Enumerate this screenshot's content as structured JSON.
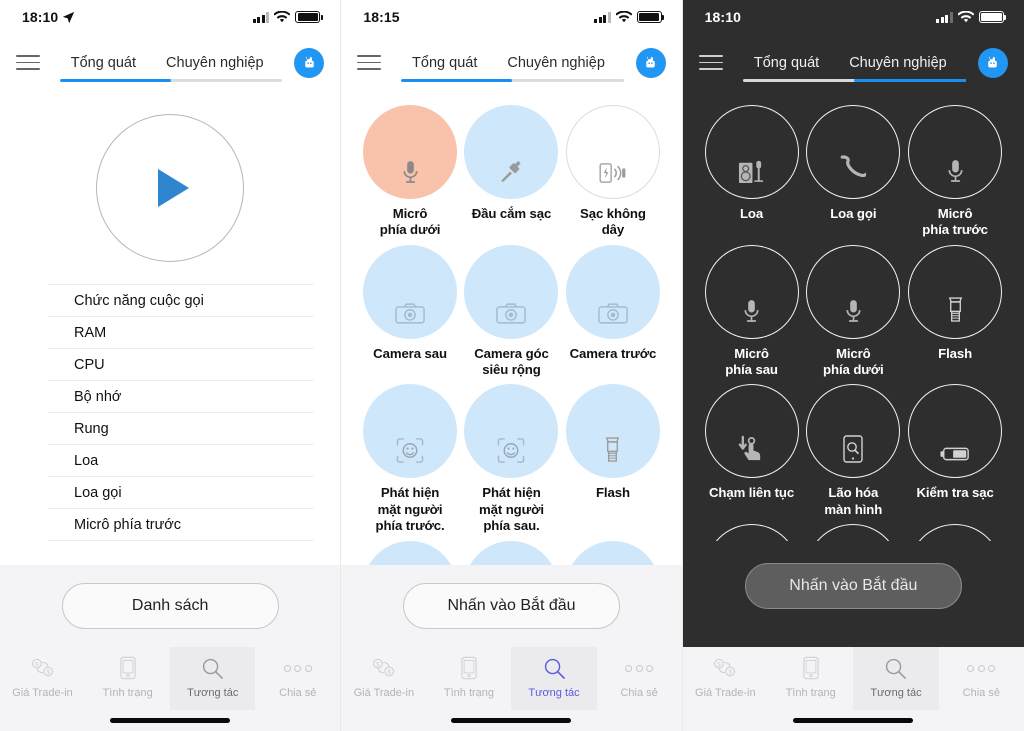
{
  "panels": [
    {
      "id": "overview",
      "status": {
        "time": "18:10",
        "location_arrow": true
      },
      "tabs": {
        "left": "Tổng quát",
        "right": "Chuyên nghiệp",
        "active": "left"
      },
      "play_button": {
        "name": "play-button"
      },
      "list": [
        "Chức năng cuộc gọi",
        "RAM",
        "CPU",
        "Bộ nhớ",
        "Rung",
        "Loa",
        "Loa gọi",
        "Micrô phía trước"
      ],
      "cta": "Danh sách",
      "tabbar": [
        {
          "label": "Giá Trade-in",
          "icon": "trade-in-icon",
          "active": false
        },
        {
          "label": "Tình trạng",
          "icon": "phone-icon",
          "active": false
        },
        {
          "label": "Tương tác",
          "icon": "search-icon",
          "active": true
        },
        {
          "label": "Chia sẻ",
          "icon": "more-dots-icon",
          "active": false
        }
      ]
    },
    {
      "id": "interactive-light",
      "status": {
        "time": "18:15",
        "location_arrow": false
      },
      "tabs": {
        "left": "Tổng quát",
        "right": "Chuyên nghiệp",
        "active": "left"
      },
      "grid": [
        {
          "label": "Micrô\nphía dưới",
          "icon": "microphone-icon",
          "style": "orange"
        },
        {
          "label": "Đầu cắm sạc",
          "icon": "charging-plug-icon",
          "style": "blue"
        },
        {
          "label": "Sạc không\ndây",
          "icon": "wireless-charging-icon",
          "style": "plain"
        },
        {
          "label": "Camera sau",
          "icon": "camera-icon",
          "style": "blue"
        },
        {
          "label": "Camera góc\nsiêu rộng",
          "icon": "camera-icon",
          "style": "blue"
        },
        {
          "label": "Camera trước",
          "icon": "camera-icon",
          "style": "blue"
        },
        {
          "label": "Phát hiện\nmặt người\nphía trước.",
          "icon": "face-detect-icon",
          "style": "blue"
        },
        {
          "label": "Phát hiện\nmặt người\nphía sau.",
          "icon": "face-detect-icon",
          "style": "blue"
        },
        {
          "label": "Flash",
          "icon": "flash-icon",
          "style": "blue"
        },
        {
          "label": "",
          "icon": "",
          "style": "blue"
        },
        {
          "label": "",
          "icon": "",
          "style": "blue"
        },
        {
          "label": "",
          "icon": "",
          "style": "blue"
        }
      ],
      "cta": "Nhấn vào Bắt đầu",
      "tabbar": [
        {
          "label": "Giá Trade-in",
          "icon": "trade-in-icon",
          "active": false
        },
        {
          "label": "Tình trạng",
          "icon": "phone-icon",
          "active": false
        },
        {
          "label": "Tương tác",
          "icon": "search-icon",
          "active": true
        },
        {
          "label": "Chia sẻ",
          "icon": "more-dots-icon",
          "active": false
        }
      ]
    },
    {
      "id": "interactive-dark",
      "status": {
        "time": "18:10",
        "location_arrow": false
      },
      "tabs": {
        "left": "Tổng quát",
        "right": "Chuyên nghiệp",
        "active": "right"
      },
      "grid": [
        {
          "label": "Loa",
          "icon": "speaker-icon"
        },
        {
          "label": "Loa gọi",
          "icon": "handset-icon"
        },
        {
          "label": "Micrô\nphía trước",
          "icon": "microphone-icon"
        },
        {
          "label": "Micrô\nphía sau",
          "icon": "microphone-icon"
        },
        {
          "label": "Micrô\nphía dưới",
          "icon": "microphone-icon"
        },
        {
          "label": "Flash",
          "icon": "flash-icon"
        },
        {
          "label": "Chạm liên tục",
          "icon": "touch-icon"
        },
        {
          "label": "Lão hóa\nmàn hình",
          "icon": "screen-burn-icon"
        },
        {
          "label": "Kiểm tra sạc",
          "icon": "battery-icon"
        },
        {
          "label": "",
          "icon": ""
        },
        {
          "label": "",
          "icon": ""
        },
        {
          "label": "",
          "icon": ""
        }
      ],
      "cta": "Nhấn vào Bắt đầu",
      "tabbar": [
        {
          "label": "Giá Trade-in",
          "icon": "trade-in-icon",
          "active": false
        },
        {
          "label": "Tình trạng",
          "icon": "phone-icon",
          "active": false
        },
        {
          "label": "Tương tác",
          "icon": "search-icon",
          "active": true
        },
        {
          "label": "Chia sẻ",
          "icon": "more-dots-icon",
          "active": false
        }
      ]
    }
  ],
  "colors": {
    "accent_blue": "#1b8ff0",
    "play_blue": "#2f86cf",
    "bubble_blue": "#cfe7fa",
    "bubble_orange": "#f9c3ab",
    "dark_bg": "#2e2e2e",
    "active_nav_light": "#5b5be0"
  }
}
